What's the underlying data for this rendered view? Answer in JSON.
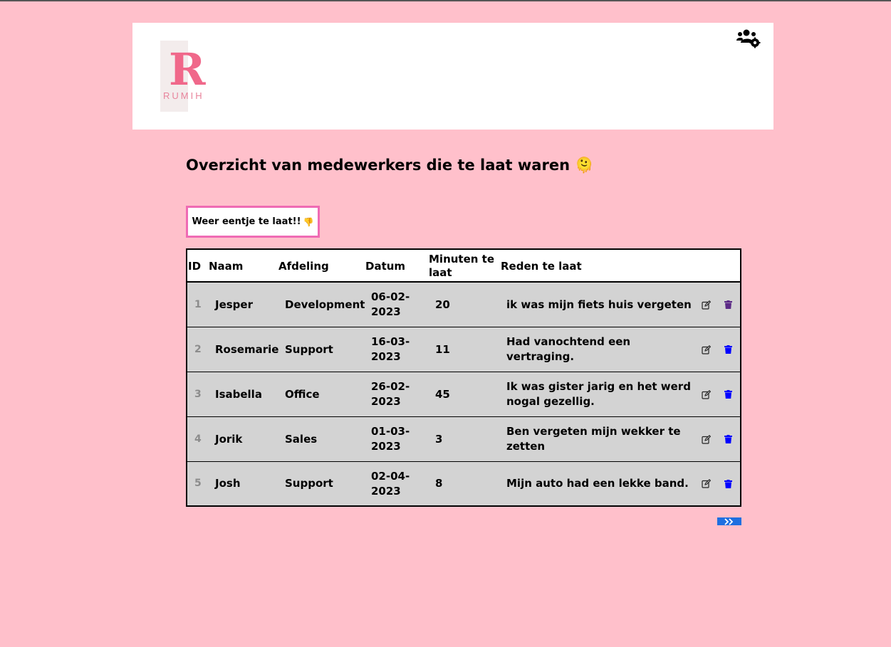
{
  "logo": {
    "letter": "R",
    "word": "RUMIH"
  },
  "page": {
    "title": "Overzicht van medewerkers die te laat waren",
    "title_emoji": "🫠"
  },
  "add_button": {
    "label": "Weer eentje te laat!!",
    "emoji": "👎"
  },
  "table": {
    "headers": [
      "ID",
      "Naam",
      "Afdeling",
      "Datum",
      "Minuten te laat",
      "Reden te laat"
    ],
    "rows": [
      {
        "id": "1",
        "name": "Jesper",
        "dept": "Development",
        "date": "06-02-2023",
        "minutes": "20",
        "reason": "ik was mijn fiets huis vergeten"
      },
      {
        "id": "2",
        "name": "Rosemarie",
        "dept": "Support",
        "date": "16-03-2023",
        "minutes": "11",
        "reason": "Had vanochtend een vertraging."
      },
      {
        "id": "3",
        "name": "Isabella",
        "dept": "Office",
        "date": "26-02-2023",
        "minutes": "45",
        "reason": "Ik was gister jarig en het werd nogal gezellig."
      },
      {
        "id": "4",
        "name": "Jorik",
        "dept": "Sales",
        "date": "01-03-2023",
        "minutes": "3",
        "reason": "Ben vergeten mijn wekker te zetten"
      },
      {
        "id": "5",
        "name": "Josh",
        "dept": "Support",
        "date": "02-04-2023",
        "minutes": "8",
        "reason": "Mijn auto had een lekke band."
      }
    ]
  },
  "icons": {
    "admin": "users-gear-icon",
    "edit": "edit-icon",
    "delete": "trash-icon",
    "next_page": "double-chevron-right-icon"
  },
  "colors": {
    "background": "#ffc0cb",
    "logo": "#f0688a",
    "button_border": "#ef6bb4",
    "row_bg": "#d3d3d3",
    "delete_icon": "#0000ff",
    "delete_icon_first": "#5b2a86",
    "pager": "#1f6fe0"
  }
}
